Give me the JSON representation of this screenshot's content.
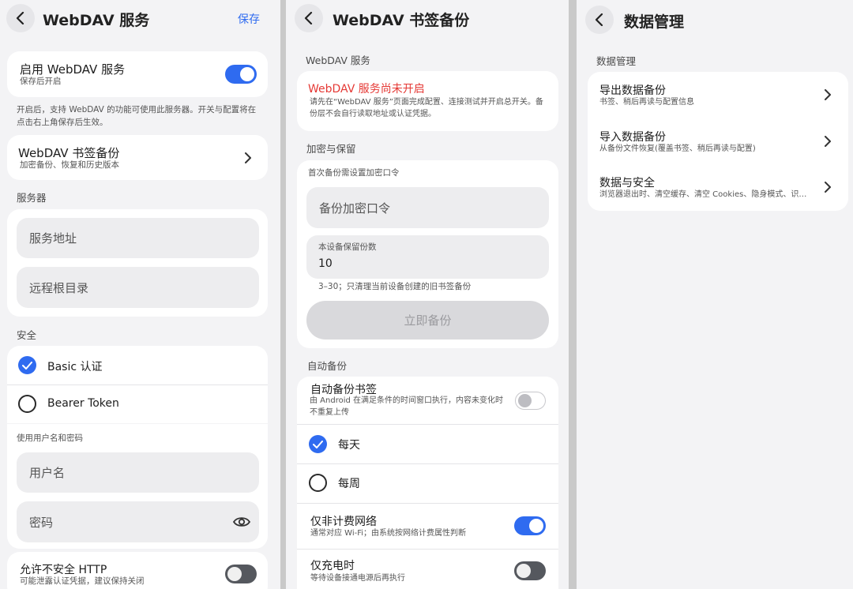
{
  "panel1": {
    "title": "WebDAV 服务",
    "save": "保存",
    "enable": {
      "label": "启用 WebDAV 服务",
      "sub": "保存后开启",
      "on": true
    },
    "enable_note": "开启后，支持 WebDAV 的功能可使用此服务器。开关与配置将在点击右上角保存后生效。",
    "bookmark_backup": {
      "label": "WebDAV 书签备份",
      "sub": "加密备份、恢复和历史版本"
    },
    "server_section": "服务器",
    "server_url_placeholder": "服务地址",
    "remote_root_placeholder": "远程根目录",
    "security_section": "安全",
    "auth_basic": "Basic 认证",
    "auth_bearer": "Bearer Token",
    "credentials_section": "使用用户名和密码",
    "username_placeholder": "用户名",
    "password_placeholder": "密码",
    "insecure_http": {
      "label": "允许不安全 HTTP",
      "sub": "可能泄露认证凭据，建议保持关闭",
      "on": false
    }
  },
  "panel2": {
    "title": "WebDAV 书签备份",
    "webdav_section": "WebDAV 服务",
    "warning_title": "WebDAV 服务尚未开启",
    "warning_text": "请先在“WebDAV 服务”页面完成配置、连接测试并开启总开关。备份层不会自行读取地址或认证凭据。",
    "encrypt_section": "加密与保留",
    "password_hint": "首次备份需设置加密口令",
    "password_placeholder": "备份加密口令",
    "keep_label": "本设备保留份数",
    "keep_value": "10",
    "keep_note": "3–30；只清理当前设备创建的旧书签备份",
    "backup_now": "立即备份",
    "auto_section": "自动备份",
    "auto_backup": {
      "label": "自动备份书签",
      "sub": "由 Android 在满足条件的时间窗口执行，内容未变化时不重复上传",
      "on": false
    },
    "freq_daily": "每天",
    "freq_weekly": "每周",
    "unmetered": {
      "label": "仅非计费网络",
      "sub": "通常对应 Wi‑Fi；由系统按网络计费属性判断",
      "on": true
    },
    "charging": {
      "label": "仅充电时",
      "sub": "等待设备接通电源后再执行",
      "on": false
    }
  },
  "panel3": {
    "title": "数据管理",
    "section": "数据管理",
    "items": [
      {
        "label": "导出数据备份",
        "sub": "书签、稍后再读与配置信息"
      },
      {
        "label": "导入数据备份",
        "sub": "从备份文件恢复(覆盖书签、稍后再读与配置)"
      },
      {
        "label": "数据与安全",
        "sub": "浏览器退出时、清空缓存、清空 Cookies、隐身模式、识…"
      }
    ]
  },
  "colors": {
    "accent": "#2f6bf0",
    "warning": "#e53935",
    "background": "#f3f3f5"
  }
}
